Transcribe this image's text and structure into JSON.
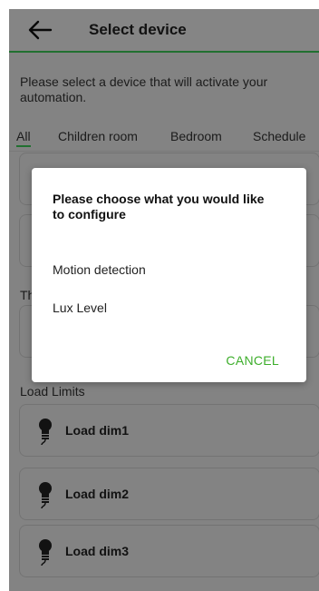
{
  "header": {
    "title": "Select device",
    "back_icon": "arrow-left-icon"
  },
  "instruction": "Please select a device that will activate your automation.",
  "tabs": [
    {
      "label": "All",
      "active": true
    },
    {
      "label": "Children room",
      "active": false
    },
    {
      "label": "Bedroom",
      "active": false
    },
    {
      "label": "Schedule",
      "active": false
    }
  ],
  "sections": [
    {
      "label": "Th"
    },
    {
      "label": "Load Limits"
    }
  ],
  "devices": [
    {
      "name": "Load dim1",
      "icon": "bulb-icon"
    },
    {
      "name": "Load dim2",
      "icon": "bulb-icon"
    },
    {
      "name": "Load dim3",
      "icon": "bulb-icon"
    }
  ],
  "dialog": {
    "title": "Please choose what you would like to configure",
    "options": [
      "Motion detection",
      "Lux Level"
    ],
    "cancel_label": "CANCEL"
  },
  "colors": {
    "accent": "#3dcd58",
    "cancel": "#3dae2b",
    "background": "#efefef"
  }
}
